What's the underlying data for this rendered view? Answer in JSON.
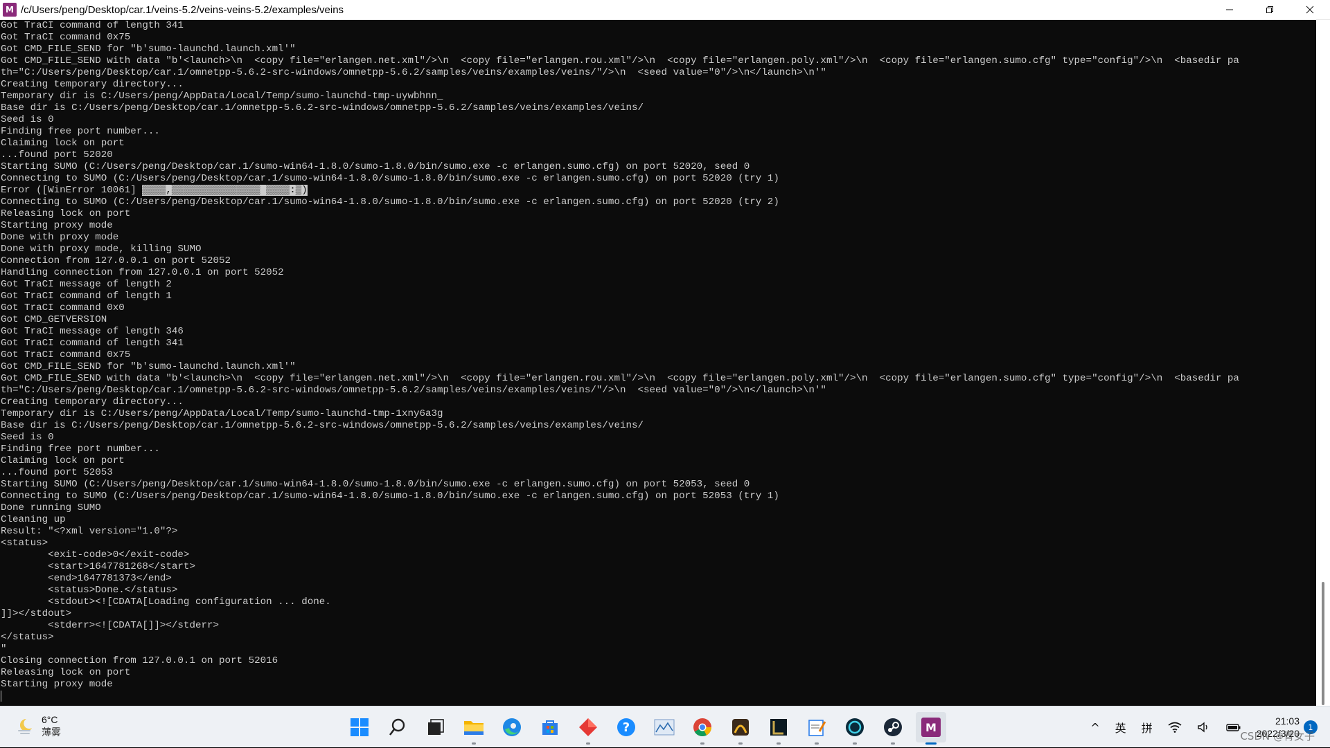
{
  "window": {
    "title": "/c/Users/peng/Desktop/car.1/veins-5.2/veins-veins-5.2/examples/veins",
    "app_icon_letter": "M",
    "controls": {
      "minimize": "minimize-icon",
      "restore": "restore-icon",
      "close": "close-icon"
    }
  },
  "terminal": {
    "lines": [
      "Got TraCI command of length 341",
      "Got TraCI command 0x75",
      "Got CMD_FILE_SEND for \"b'sumo-launchd.launch.xml'\"",
      "Got CMD_FILE_SEND with data \"b'<launch>\\n  <copy file=\"erlangen.net.xml\"/>\\n  <copy file=\"erlangen.rou.xml\"/>\\n  <copy file=\"erlangen.poly.xml\"/>\\n  <copy file=\"erlangen.sumo.cfg\" type=\"config\"/>\\n  <basedir pa",
      "th=\"C:/Users/peng/Desktop/car.1/omnetpp-5.6.2-src-windows/omnetpp-5.6.2/samples/veins/examples/veins/\"/>\\n  <seed value=\"0\"/>\\n</launch>\\n'\"",
      "Creating temporary directory...",
      "Temporary dir is C:/Users/peng/AppData/Local/Temp/sumo-launchd-tmp-uywbhnn_",
      "Base dir is C:/Users/peng/Desktop/car.1/omnetpp-5.6.2-src-windows/omnetpp-5.6.2/samples/veins/examples/veins/",
      "Seed is 0",
      "Finding free port number...",
      "Claiming lock on port",
      "...found port 52020",
      "Starting SUMO (C:/Users/peng/Desktop/car.1/sumo-win64-1.8.0/sumo-1.8.0/bin/sumo.exe -c erlangen.sumo.cfg) on port 52020, seed 0",
      "Connecting to SUMO (C:/Users/peng/Desktop/car.1/sumo-win64-1.8.0/sumo-1.8.0/bin/sumo.exe -c erlangen.sumo.cfg) on port 52020 (try 1)",
      "Error ([WinError 10061] ",
      "Connecting to SUMO (C:/Users/peng/Desktop/car.1/sumo-win64-1.8.0/sumo-1.8.0/bin/sumo.exe -c erlangen.sumo.cfg) on port 52020 (try 2)",
      "Releasing lock on port",
      "Starting proxy mode",
      "Done with proxy mode",
      "Done with proxy mode, killing SUMO",
      "Connection from 127.0.0.1 on port 52052",
      "Handling connection from 127.0.0.1 on port 52052",
      "Got TraCI message of length 2",
      "Got TraCI command of length 1",
      "Got TraCI command 0x0",
      "Got CMD_GETVERSION",
      "Got TraCI message of length 346",
      "Got TraCI command of length 341",
      "Got TraCI command 0x75",
      "Got CMD_FILE_SEND for \"b'sumo-launchd.launch.xml'\"",
      "Got CMD_FILE_SEND with data \"b'<launch>\\n  <copy file=\"erlangen.net.xml\"/>\\n  <copy file=\"erlangen.rou.xml\"/>\\n  <copy file=\"erlangen.poly.xml\"/>\\n  <copy file=\"erlangen.sumo.cfg\" type=\"config\"/>\\n  <basedir pa",
      "th=\"C:/Users/peng/Desktop/car.1/omnetpp-5.6.2-src-windows/omnetpp-5.6.2/samples/veins/examples/veins/\"/>\\n  <seed value=\"0\"/>\\n</launch>\\n'\"",
      "Creating temporary directory...",
      "Temporary dir is C:/Users/peng/AppData/Local/Temp/sumo-launchd-tmp-1xny6a3g",
      "Base dir is C:/Users/peng/Desktop/car.1/omnetpp-5.6.2-src-windows/omnetpp-5.6.2/samples/veins/examples/veins/",
      "Seed is 0",
      "Finding free port number...",
      "Claiming lock on port",
      "...found port 52053",
      "Starting SUMO (C:/Users/peng/Desktop/car.1/sumo-win64-1.8.0/sumo-1.8.0/bin/sumo.exe -c erlangen.sumo.cfg) on port 52053, seed 0",
      "Connecting to SUMO (C:/Users/peng/Desktop/car.1/sumo-win64-1.8.0/sumo-1.8.0/bin/sumo.exe -c erlangen.sumo.cfg) on port 52053 (try 1)",
      "Done running SUMO",
      "Cleaning up",
      "Result: \"<?xml version=\"1.0\"?>",
      "<status>",
      "        <exit-code>0</exit-code>",
      "        <start>1647781268</start>",
      "        <end>1647781373</end>",
      "        <status>Done.</status>",
      "        <stdout><![CDATA[Loading configuration ... done.",
      "]]></stdout>",
      "        <stderr><![CDATA[]]></stderr>",
      "</status>",
      "\"",
      "Closing connection from 127.0.0.1 on port 52016",
      "Releasing lock on port",
      "Starting proxy mode",
      ""
    ],
    "error_line_index": 14,
    "error_garbled_suffix": "▒▒▒▒,▒▒▒▒▒▒▒▒▒▒▒▒▒▒▒ ▒▒▒▒:▒)",
    "colors": {
      "background": "#0c0c0c",
      "text": "#cccccc"
    }
  },
  "taskbar": {
    "weather": {
      "temp": "6°C",
      "condition": "薄雾"
    },
    "apps": [
      {
        "name": "start-icon",
        "running": false
      },
      {
        "name": "search-icon",
        "running": false
      },
      {
        "name": "task-view-icon",
        "running": false
      },
      {
        "name": "file-explorer-icon",
        "running": true
      },
      {
        "name": "edge-browser-icon",
        "running": false
      },
      {
        "name": "microsoft-store-icon",
        "running": false
      },
      {
        "name": "red-diamond-app-icon",
        "running": true
      },
      {
        "name": "help-icon",
        "running": false
      },
      {
        "name": "chart-app-icon",
        "running": false
      },
      {
        "name": "chrome-icon",
        "running": true
      },
      {
        "name": "game-app-icon",
        "running": true
      },
      {
        "name": "league-of-legends-icon",
        "running": true
      },
      {
        "name": "notepad-icon",
        "running": true
      },
      {
        "name": "circle-app-icon",
        "running": true
      },
      {
        "name": "steam-icon",
        "running": true
      },
      {
        "name": "msys2-terminal-icon",
        "running": true,
        "active": true
      }
    ],
    "tray": {
      "chevron": "^",
      "ime_lang": "英",
      "ime_mode": "拼",
      "time": "21:03",
      "date": "2022/3/20",
      "notifications": "1"
    },
    "watermark": "CSDN @青女子"
  }
}
